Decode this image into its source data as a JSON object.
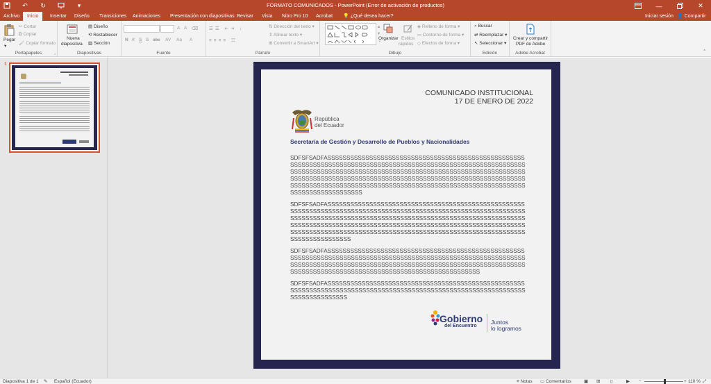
{
  "window": {
    "title": "FORMATO COMUNICADOS - PowerPoint (Error de activación de productos)"
  },
  "tabs": [
    {
      "label": "Archivo"
    },
    {
      "label": "Inicio"
    },
    {
      "label": "Insertar"
    },
    {
      "label": "Diseño"
    },
    {
      "label": "Transiciones"
    },
    {
      "label": "Animaciones"
    },
    {
      "label": "Presentación con diapositivas"
    },
    {
      "label": "Revisar"
    },
    {
      "label": "Vista"
    },
    {
      "label": "Nitro Pro 10"
    },
    {
      "label": "Acrobat"
    }
  ],
  "tell_me": "¿Qué desea hacer?",
  "account": {
    "signin": "Iniciar sesión",
    "share": "Compartir"
  },
  "ribbon": {
    "clipboard": {
      "label": "Portapapeles",
      "paste": "Pegar",
      "cut": "Cortar",
      "copy": "Copiar",
      "format_painter": "Copiar formato"
    },
    "slides": {
      "label": "Diapositivas",
      "new_slide_1": "Nueva",
      "new_slide_2": "diapositiva",
      "layout": "Diseño",
      "reset": "Restablecer",
      "section": "Sección"
    },
    "font": {
      "label": "Fuente",
      "bold": "N",
      "italic": "K",
      "underline": "S",
      "strike": "S",
      "shadow": "abc",
      "spacing": "AV",
      "case": "Aa",
      "color": "A"
    },
    "paragraph": {
      "label": "Párrafo",
      "text_direction": "Dirección del texto",
      "align_text": "Alinear texto",
      "smartart": "Convertir a SmartArt"
    },
    "drawing": {
      "label": "Dibujo",
      "arrange": "Organizar",
      "quick_styles_1": "Estilos",
      "quick_styles_2": "rápidos",
      "fill": "Relleno de forma",
      "outline": "Contorno de forma",
      "effects": "Efectos de forma"
    },
    "editing": {
      "label": "Edición",
      "find": "Buscar",
      "replace": "Reemplazar",
      "select": "Seleccionar"
    },
    "acrobat": {
      "label": "Adobe Acrobat",
      "create_1": "Crear y compartir",
      "create_2": "PDF de Adobe"
    }
  },
  "thumb": {
    "number": "1"
  },
  "slide": {
    "title_line1": "COMUNICADO INSTITUCIONAL",
    "title_line2": "17 DE ENERO DE 2022",
    "republic_1": "República",
    "republic_2": "del Ecuador",
    "secretaria": "Secretaría de Gestión y Desarrollo de Pueblos y Nacionalidades",
    "paragraphs": [
      "SDFSFSADFASSSSSSSSSSSSSSSSSSSSSSSSSSSSSSSSSSSSSSSSSSSSSSSSSSSSSSSSSSSSSSSSSSSSSSSSSSSSSSSSSSSSSSSSSSSSSSSSSSSSSSSSSSSSSSSSSSSSSSSSSSSSSSSSSSSSSSSSSSSSSSSSSSSSSSSSSSSSSSSSSSSSSSSSSSSSSSSSSSSSSSSSSSSSSSSSSSSSSSSSSSSSSSSSSSSSSSSSSSSSSSSSSSSSSSSSSSSSSSSSSSSSSSSSSSSSSSSSSSSSSSSSSSSSSSSSSSSSSSSSSSSSSSSSSSSSSSSSSSSSSSSSSSSSSSSSSSSSSSS",
      "SDFSFSADFASSSSSSSSSSSSSSSSSSSSSSSSSSSSSSSSSSSSSSSSSSSSSSSSSSSSSSSSSSSSSSSSSSSSSSSSSSSSSSSSSSSSSSSSSSSSSSSSSSSSSSSSSSSSSSSSSSSSSSSSSSSSSSSSSSSSSSSSSSSSSSSSSSSSSSSSSSSSSSSSSSSSSSSSSSSSSSSSSSSSSSSSSSSSSSSSSSSSSSSSSSSSSSSSSSSSSSSSSSSSSSSSSSSSSSSSSSSSSSSSSSSSSSSSSSSSSSSSSSSSSSSSSSSSSSSSSSSSSSSSSSSSSSSSSSSSSSSSSSSSSSSSSSSSSSSSSSSS",
      "SDFSFSADFASSSSSSSSSSSSSSSSSSSSSSSSSSSSSSSSSSSSSSSSSSSSSSSSSSSSSSSSSSSSSSSSSSSSSSSSSSSSSSSSSSSSSSSSSSSSSSSSSSSSSSSSSSSSSSSSSSSSSSSSSSSSSSSSSSSSSSSSSSSSSSSSSSSSSSSSSSSSSSSSSSSSSSSSSSSSSSSSSSSSSSSSSSSSSSSSSSSSSSSSSSSSSSSSSSSSSSSSSSSSSSSSSS",
      "SDFSFSADFASSSSSSSSSSSSSSSSSSSSSSSSSSSSSSSSSSSSSSSSSSSSSSSSSSSSSSSSSSSSSSSSSSSSSSSSSSSSSSSSSSSSSSSSSSSSSSSSSSSSSSSSSSSSSSSSSSSSSSSSSSSSSSSSS"
    ],
    "gob_1": "Gobierno",
    "gob_2": "del Encuentro",
    "slogan_1": "Juntos",
    "slogan_2": "lo logramos"
  },
  "status": {
    "slide": "Diapositiva 1 de 1",
    "language": "Español (Ecuador)",
    "notes": "Notas",
    "comments": "Comentarios",
    "zoom": "110 %"
  },
  "colors": {
    "accent": "#b7472a",
    "slide_border": "#25254f",
    "brand_blue": "#2e3a75"
  }
}
